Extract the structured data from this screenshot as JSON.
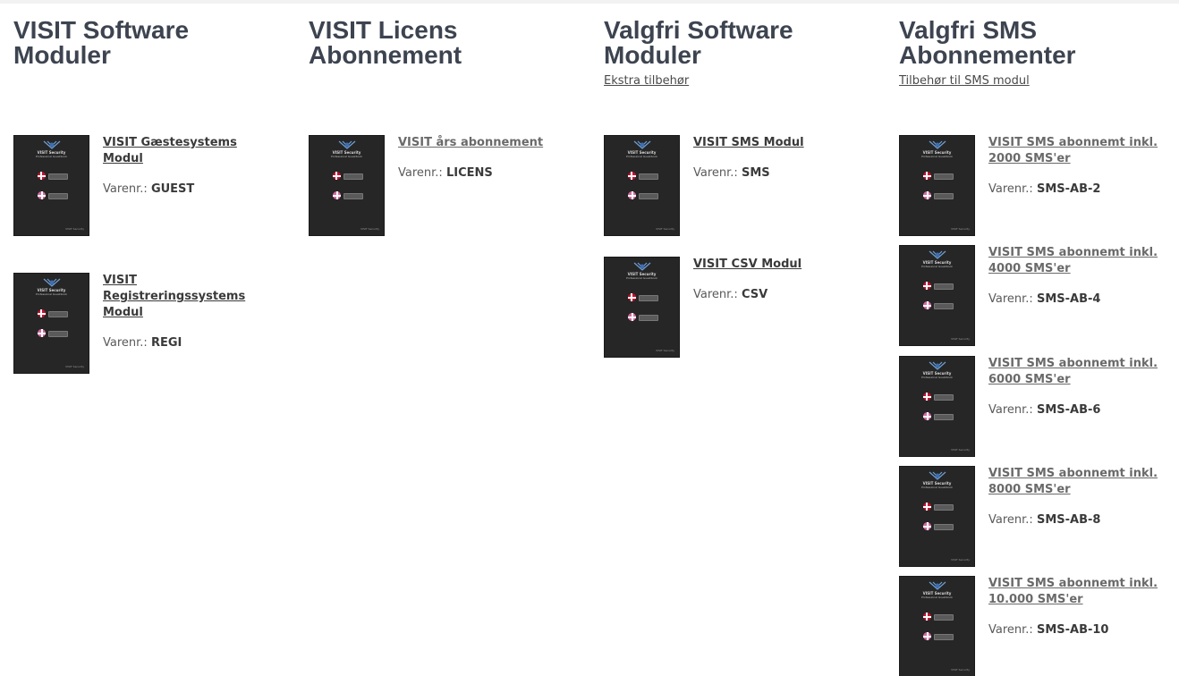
{
  "columns": [
    {
      "heading_line1": "VISIT Software",
      "heading_line2": "Moduler",
      "sublink": "",
      "products": [
        {
          "title": "VISIT Gæstesystems Modul",
          "sku_label": "Varenr.:",
          "sku": "GUEST"
        },
        {
          "title": "VISIT Registreringssystems Modul",
          "sku_label": "Varenr.:",
          "sku": "REGI"
        }
      ]
    },
    {
      "heading_line1": "VISIT Licens",
      "heading_line2": "Abonnement",
      "sublink": "",
      "products": [
        {
          "title": "VISIT års abonnement",
          "sku_label": "Varenr.:",
          "sku": "LICENS"
        }
      ]
    },
    {
      "heading_line1": "Valgfri Software",
      "heading_line2": "Moduler",
      "sublink": "Ekstra tilbehør",
      "products": [
        {
          "title": "VISIT SMS Modul",
          "sku_label": "Varenr.:",
          "sku": "SMS"
        },
        {
          "title": "VISIT CSV Modul",
          "sku_label": "Varenr.:",
          "sku": "CSV"
        }
      ]
    },
    {
      "heading_line1": "Valgfri SMS",
      "heading_line2": "Abonnementer",
      "sublink": "Tilbehør til SMS modul",
      "products": [
        {
          "title": "VISIT SMS abonnemt inkl. 2000 SMS'er",
          "sku_label": "Varenr.:",
          "sku": "SMS-AB-2"
        },
        {
          "title": "VISIT SMS abonnemt inkl. 4000 SMS'er",
          "sku_label": "Varenr.:",
          "sku": "SMS-AB-4"
        },
        {
          "title": "VISIT SMS abonnemt inkl. 6000 SMS'er",
          "sku_label": "Varenr.:",
          "sku": "SMS-AB-6"
        },
        {
          "title": "VISIT SMS abonnemt inkl. 8000 SMS'er",
          "sku_label": "Varenr.:",
          "sku": "SMS-AB-8"
        },
        {
          "title": "VISIT SMS abonnemt inkl. 10.000 SMS'er",
          "sku_label": "Varenr.:",
          "sku": "SMS-AB-10"
        }
      ]
    }
  ],
  "thumbnail": {
    "brand": "VISIT Security",
    "tagline": "Professional Guestbook",
    "footer": "VISIT Security"
  }
}
